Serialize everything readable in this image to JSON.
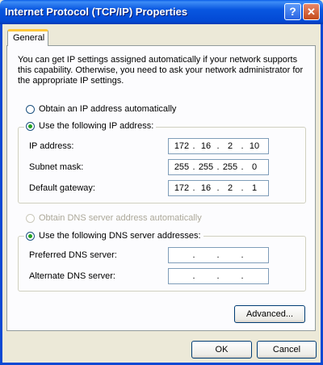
{
  "window": {
    "title": "Internet Protocol (TCP/IP) Properties",
    "help_label": "?",
    "close_label": "✕"
  },
  "tabs": [
    {
      "label": "General",
      "selected": true
    }
  ],
  "intro_text": "You can get IP settings assigned automatically if your network supports this capability. Otherwise, you need to ask your network administrator for the appropriate IP settings.",
  "ip": {
    "auto_label": "Obtain an IP address automatically",
    "manual_label": "Use the following IP address:",
    "selected": "manual",
    "fields": [
      {
        "label": "IP address:",
        "octets": [
          "172",
          "16",
          "2",
          "10"
        ]
      },
      {
        "label": "Subnet mask:",
        "octets": [
          "255",
          "255",
          "255",
          "0"
        ]
      },
      {
        "label": "Default gateway:",
        "octets": [
          "172",
          "16",
          "2",
          "1"
        ]
      }
    ]
  },
  "dns": {
    "auto_label": "Obtain DNS server address automatically",
    "manual_label": "Use the following DNS server addresses:",
    "selected": "manual",
    "fields": [
      {
        "label": "Preferred DNS server:",
        "octets": [
          "",
          "",
          "",
          ""
        ]
      },
      {
        "label": "Alternate DNS server:",
        "octets": [
          "",
          "",
          "",
          ""
        ]
      }
    ]
  },
  "buttons": {
    "advanced": "Advanced...",
    "ok": "OK",
    "cancel": "Cancel"
  },
  "dot_char": "."
}
